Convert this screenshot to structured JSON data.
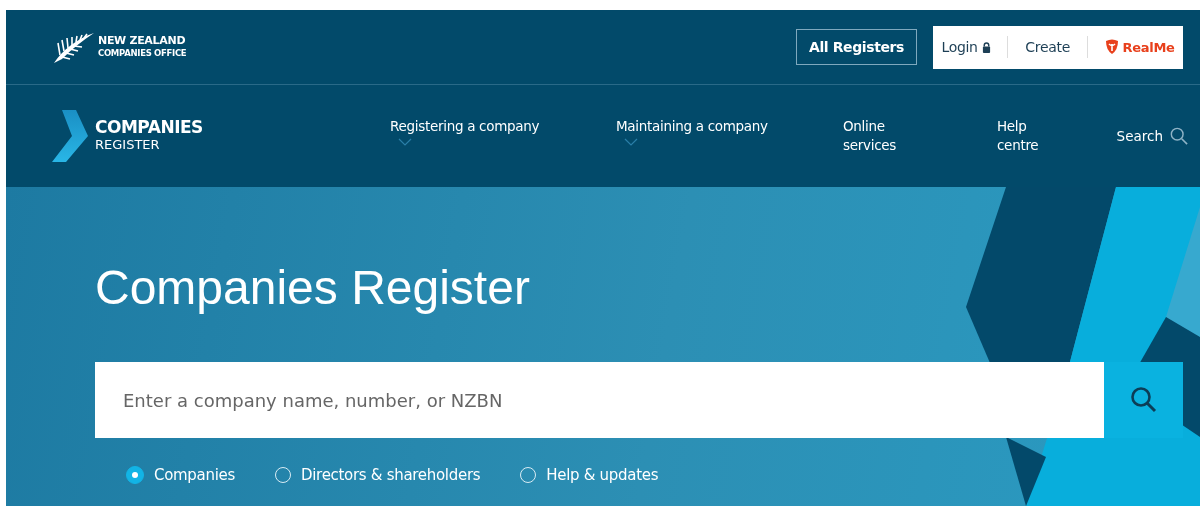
{
  "header": {
    "logo": {
      "line_1": "NEW ZEALAND",
      "line_2": "COMPANIES OFFICE"
    },
    "all_registers": "All Registers",
    "account": [
      {
        "label": "Login",
        "kind": "login"
      },
      {
        "label": "Create",
        "kind": "link"
      },
      {
        "label": "RealMe",
        "kind": "brand"
      }
    ]
  },
  "nav": {
    "logo": {
      "line_1": "COMPANIES",
      "line_2": "REGISTER"
    },
    "items": [
      {
        "label": "Registering a company",
        "kind": "dropdown"
      },
      {
        "label": "Maintaining a company",
        "kind": "dropdown"
      },
      {
        "label": "Online services",
        "kind": "link"
      },
      {
        "label": "Help centre",
        "kind": "link"
      }
    ],
    "search": "Search"
  },
  "hero": {
    "title": "Companies Register",
    "search": {
      "placeholder": "Enter a company name, number, or NZBN"
    },
    "options": [
      {
        "label": "Companies",
        "selected": true
      },
      {
        "label": "Directors & shareholders",
        "selected": false
      },
      {
        "label": "Help & updates",
        "selected": false
      }
    ]
  }
}
